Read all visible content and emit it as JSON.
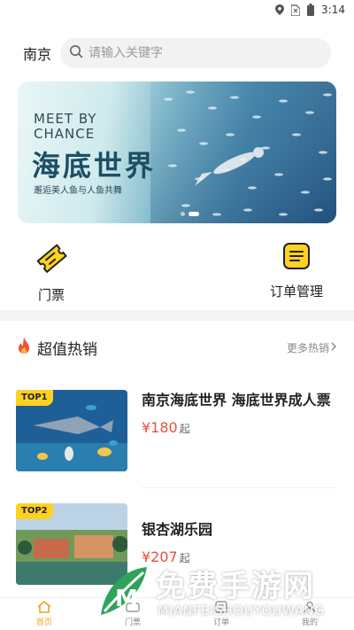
{
  "status_bar": {
    "time": "3:14",
    "icons": [
      "location-icon",
      "sim-icon",
      "battery-icon"
    ]
  },
  "header": {
    "city": "南京",
    "search_placeholder": "请输入关键字"
  },
  "banner": {
    "eng_line1": "MEET BY",
    "eng_line2": "CHANCE",
    "title": "海底世界",
    "subtitle": "邂逅美人鱼与人鱼共舞",
    "page_count": 2,
    "active_index": 1
  },
  "quick_entries": [
    {
      "label": "门票",
      "icon": "ticket-icon"
    },
    {
      "label": "订单管理",
      "icon": "order-list-icon"
    }
  ],
  "hot_section": {
    "title": "超值热销",
    "more": "更多热销",
    "icon": "flame-icon"
  },
  "products": [
    {
      "rank": "TOP1",
      "name": "南京海底世界 海底世界成人票",
      "price": "¥180",
      "unit": "起"
    },
    {
      "rank": "TOP2",
      "name": "银杏湖乐园",
      "price": "¥207",
      "unit": "起"
    }
  ],
  "bottom_nav": [
    {
      "label": "首页",
      "icon": "home-icon",
      "active": true
    },
    {
      "label": "门票",
      "icon": "ticket-icon",
      "active": false
    },
    {
      "label": "订单",
      "icon": "order-icon",
      "active": false
    },
    {
      "label": "我的",
      "icon": "user-icon",
      "active": false
    }
  ],
  "watermark": {
    "title": "免费手游网",
    "sub": "MIANFEISHOUYOUWANG"
  },
  "colors": {
    "accent": "#ffd21f",
    "price": "#e8503a",
    "nav_active": "#f3a21c"
  }
}
